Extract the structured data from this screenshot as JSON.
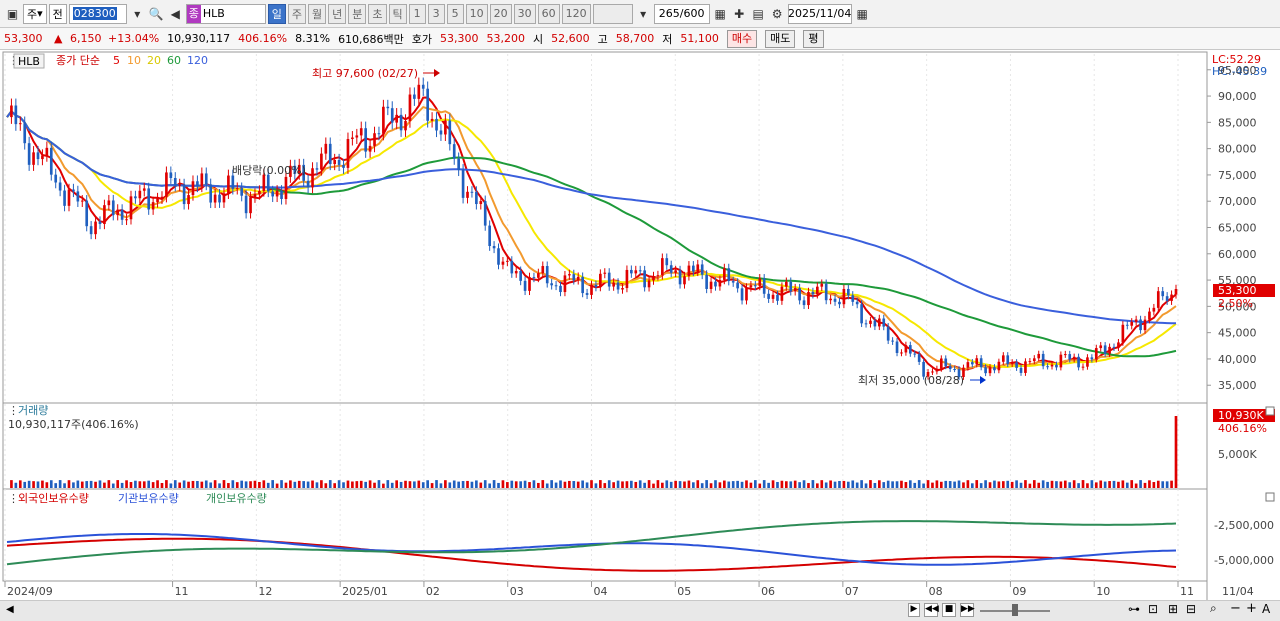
{
  "toolbar": {
    "period_type": "주",
    "prev_label": "전",
    "code": "028300",
    "stock_badge": "종",
    "stock_name": "HLB",
    "periods": [
      "일",
      "주",
      "월",
      "년",
      "분",
      "초",
      "틱",
      "1",
      "3",
      "5",
      "10",
      "20",
      "30",
      "60",
      "120"
    ],
    "active_period": "일",
    "count_value": "265",
    "count_total": "/600",
    "date": "2025/11/04"
  },
  "quote": {
    "price": "53,300",
    "change": "6,150",
    "change_pct": "+13.04%",
    "volume": "10,930,117",
    "volume_pct": "406.16%",
    "turnover": "8.31%",
    "amount": "610,686백만",
    "ask_label": "호가",
    "ask": "53,300",
    "bid": "53,200",
    "open_label": "시",
    "open": "52,600",
    "high_label": "고",
    "high": "58,700",
    "low_label": "저",
    "low": "51,100",
    "buy_label": "매수",
    "sell_label": "매도",
    "eval_label": "평"
  },
  "price_panel": {
    "title": "HLB",
    "ma_label": "종가 단순",
    "ma_periods": [
      "5",
      "10",
      "20",
      "60",
      "120"
    ],
    "ma_colors": [
      "#e00000",
      "#f29a2e",
      "#f6e800",
      "#1e9a3a",
      "#3a5fdc"
    ],
    "lc": "LC:52.29",
    "hc": "HC:-45.39",
    "high_note": "최고 97,600 (02/27)",
    "low_note": "최저 35,000 (08/28)",
    "dividend_note": "배당락(0.00%)",
    "last_price": "53,300",
    "last_pct": "2.50%",
    "y_ticks": [
      "95,000",
      "90,000",
      "85,000",
      "80,000",
      "75,000",
      "70,000",
      "65,000",
      "60,000",
      "55,000",
      "50,000",
      "45,000",
      "40,000",
      "35,000"
    ]
  },
  "volume_panel": {
    "title": "거래량",
    "value_text": "10,930,117주(406.16%)",
    "last_label": "10,930K",
    "last_pct": "406.16%",
    "y_ticks": [
      "5,000K"
    ]
  },
  "holding_panel": {
    "legend": [
      "외국인보유수량",
      "기관보유수량",
      "개인보유수량"
    ],
    "colors": [
      "#d40000",
      "#2b52d8",
      "#2e8b57"
    ],
    "y_ticks": [
      "-2,500,000",
      "-5,000,000"
    ]
  },
  "x_axis": {
    "labels": [
      "2024/09",
      "11",
      "12",
      "2025/01",
      "02",
      "03",
      "04",
      "05",
      "06",
      "07",
      "08",
      "09",
      "10",
      "11"
    ],
    "end_label": "11/04"
  },
  "chart_data": {
    "type": "candlestick",
    "title": "HLB",
    "price_range": [
      32000,
      98000
    ],
    "highest": {
      "value": 97600,
      "date": "02/27"
    },
    "lowest": {
      "value": 35000,
      "date": "08/28"
    },
    "close_trend": [
      {
        "month": "2024/09",
        "value": 86000
      },
      {
        "month": "2024/10",
        "value": 66000
      },
      {
        "month": "2024/11",
        "value": 73000
      },
      {
        "month": "2024/12",
        "value": 71000
      },
      {
        "month": "2025/01",
        "value": 79000
      },
      {
        "month": "2025/02",
        "value": 90000
      },
      {
        "month": "2025/03",
        "value": 56000
      },
      {
        "month": "2025/04",
        "value": 54000
      },
      {
        "month": "2025/05",
        "value": 57000
      },
      {
        "month": "2025/06",
        "value": 53000
      },
      {
        "month": "2025/07",
        "value": 52000
      },
      {
        "month": "2025/08",
        "value": 38000
      },
      {
        "month": "2025/09",
        "value": 39000
      },
      {
        "month": "2025/10",
        "value": 40000
      },
      {
        "month": "2025/11",
        "value": 53300
      }
    ],
    "last_volume": 10930117
  }
}
